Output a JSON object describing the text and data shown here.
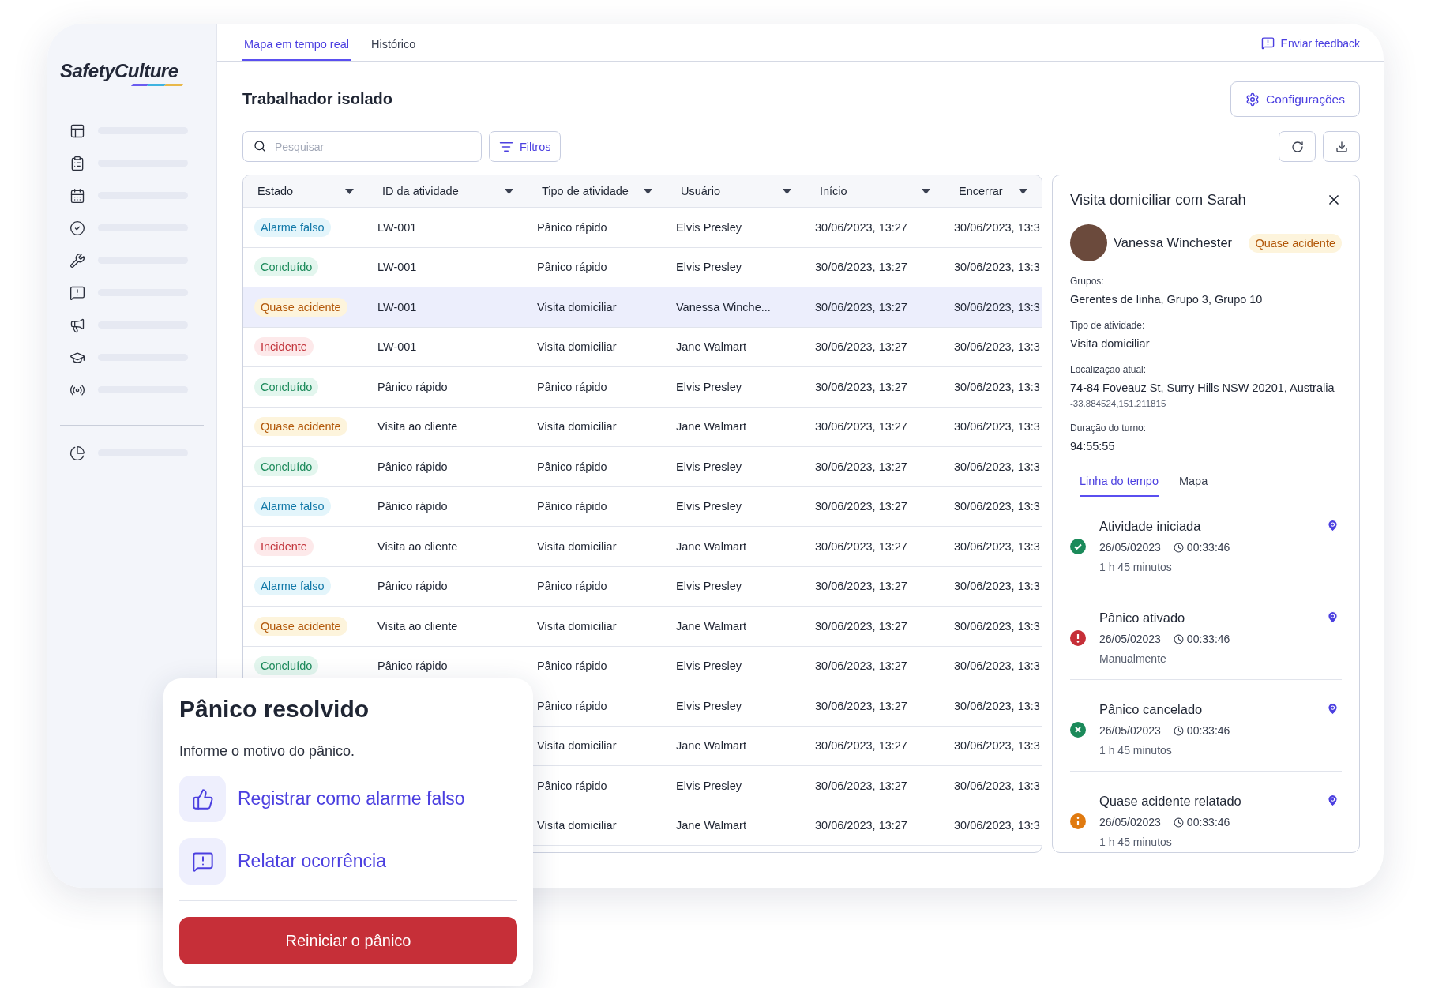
{
  "logo": "SafetyCulture",
  "tabs": [
    {
      "label": "Mapa em tempo real",
      "selected": true
    },
    {
      "label": "Histórico",
      "selected": false
    }
  ],
  "feedback_link": "Enviar feedback",
  "page_title": "Trabalhador isolado",
  "settings_button": "Configurações",
  "search": {
    "placeholder": "Pesquisar"
  },
  "filters_button": "Filtros",
  "table": {
    "columns": [
      "Estado",
      "ID da atividade",
      "Tipo de atividade",
      "Usuário",
      "Início",
      "Encerrar"
    ],
    "rows": [
      {
        "status": {
          "kind": "false_alarm",
          "label": "Alarme falso"
        },
        "id": "LW-001",
        "type": "Pânico rápido",
        "user": "Elvis Presley",
        "start": "30/06/2023, 13:27",
        "end": "30/06/2023, 13:3",
        "selected": false
      },
      {
        "status": {
          "kind": "done",
          "label": "Concluído"
        },
        "id": "LW-001",
        "type": "Pânico rápido",
        "user": "Elvis Presley",
        "start": "30/06/2023, 13:27",
        "end": "30/06/2023, 13:3",
        "selected": false
      },
      {
        "status": {
          "kind": "near_miss",
          "label": "Quase acidente"
        },
        "id": "LW-001",
        "type": "Visita domiciliar",
        "user": "Vanessa Winche...",
        "start": "30/06/2023, 13:27",
        "end": "30/06/2023, 13:3",
        "selected": true
      },
      {
        "status": {
          "kind": "incident",
          "label": "Incidente"
        },
        "id": "LW-001",
        "type": "Visita domiciliar",
        "user": "Jane Walmart",
        "start": "30/06/2023, 13:27",
        "end": "30/06/2023, 13:3",
        "selected": false
      },
      {
        "status": {
          "kind": "done",
          "label": "Concluído"
        },
        "id": "Pânico rápido",
        "type": "Pânico rápido",
        "user": "Elvis Presley",
        "start": "30/06/2023, 13:27",
        "end": "30/06/2023, 13:3",
        "selected": false
      },
      {
        "status": {
          "kind": "near_miss",
          "label": "Quase acidente"
        },
        "id": "Visita ao cliente",
        "type": "Visita domiciliar",
        "user": "Jane Walmart",
        "start": "30/06/2023, 13:27",
        "end": "30/06/2023, 13:3",
        "selected": false
      },
      {
        "status": {
          "kind": "done",
          "label": "Concluído"
        },
        "id": "Pânico rápido",
        "type": "Pânico rápido",
        "user": "Elvis Presley",
        "start": "30/06/2023, 13:27",
        "end": "30/06/2023, 13:3",
        "selected": false
      },
      {
        "status": {
          "kind": "false_alarm",
          "label": "Alarme falso"
        },
        "id": "Pânico rápido",
        "type": "Pânico rápido",
        "user": "Elvis Presley",
        "start": "30/06/2023, 13:27",
        "end": "30/06/2023, 13:3",
        "selected": false
      },
      {
        "status": {
          "kind": "incident",
          "label": "Incidente"
        },
        "id": "Visita ao cliente",
        "type": "Visita domiciliar",
        "user": "Jane Walmart",
        "start": "30/06/2023, 13:27",
        "end": "30/06/2023, 13:3",
        "selected": false
      },
      {
        "status": {
          "kind": "false_alarm",
          "label": "Alarme falso"
        },
        "id": "Pânico rápido",
        "type": "Pânico rápido",
        "user": "Elvis Presley",
        "start": "30/06/2023, 13:27",
        "end": "30/06/2023, 13:3",
        "selected": false
      },
      {
        "status": {
          "kind": "near_miss",
          "label": "Quase acidente"
        },
        "id": "Visita ao cliente",
        "type": "Visita domiciliar",
        "user": "Jane Walmart",
        "start": "30/06/2023, 13:27",
        "end": "30/06/2023, 13:3",
        "selected": false
      },
      {
        "status": {
          "kind": "done",
          "label": "Concluído"
        },
        "id": "Pânico rápido",
        "type": "Pânico rápido",
        "user": "Elvis Presley",
        "start": "30/06/2023, 13:27",
        "end": "30/06/2023, 13:3",
        "selected": false
      },
      {
        "type": "Pânico rápido",
        "user": "Elvis Presley",
        "start": "30/06/2023, 13:27",
        "end": "30/06/2023, 13:3",
        "selected": false
      },
      {
        "type": "Visita domiciliar",
        "user": "Jane Walmart",
        "start": "30/06/2023, 13:27",
        "end": "30/06/2023, 13:3",
        "selected": false
      },
      {
        "type": "Pânico rápido",
        "user": "Elvis Presley",
        "start": "30/06/2023, 13:27",
        "end": "30/06/2023, 13:3",
        "selected": false
      },
      {
        "type": "Visita domiciliar",
        "user": "Jane Walmart",
        "start": "30/06/2023, 13:27",
        "end": "30/06/2023, 13:3",
        "selected": false
      }
    ]
  },
  "detail": {
    "title": "Visita domiciliar com Sarah",
    "person": "Vanessa Winchester",
    "status": {
      "kind": "near_miss",
      "label": "Quase acidente"
    },
    "fields": [
      {
        "label": "Grupos:",
        "value": "Gerentes de linha, Grupo 3, Grupo 10"
      },
      {
        "label": "Tipo de atividade:",
        "value": "Visita domiciliar"
      },
      {
        "label": "Localização atual:",
        "value": "74-84 Foveauz St, Surry Hills NSW 20201, Australia",
        "note": "-33.884524,151.211815"
      },
      {
        "label": "Duração do turno:",
        "value": "94:55:55"
      }
    ],
    "tabs": [
      {
        "label": "Linha do tempo",
        "selected": true
      },
      {
        "label": "Mapa",
        "selected": false
      }
    ],
    "timeline": [
      {
        "kind": "success",
        "title": "Atividade iniciada",
        "date": "26/05/02023",
        "time": "00:33:46",
        "note": "1 h 45 minutos"
      },
      {
        "kind": "error",
        "title": "Pânico ativado",
        "date": "26/05/02023",
        "time": "00:33:46",
        "note": "Manualmente"
      },
      {
        "kind": "cancelled",
        "title": "Pânico cancelado",
        "date": "26/05/02023",
        "time": "00:33:46",
        "note": "1 h 45 minutos"
      },
      {
        "kind": "warning",
        "title": "Quase acidente relatado",
        "date": "26/05/02023",
        "time": "00:33:46",
        "note": "1 h 45 minutos"
      }
    ]
  },
  "dialog": {
    "title": "Pânico resolvido",
    "text": "Informe o motivo do pânico.",
    "actions": [
      {
        "kind": "false_alarm",
        "label": "Registrar como alarme falso"
      },
      {
        "kind": "report",
        "label": "Relatar ocorrência"
      }
    ],
    "button": "Reiniciar o pânico"
  }
}
